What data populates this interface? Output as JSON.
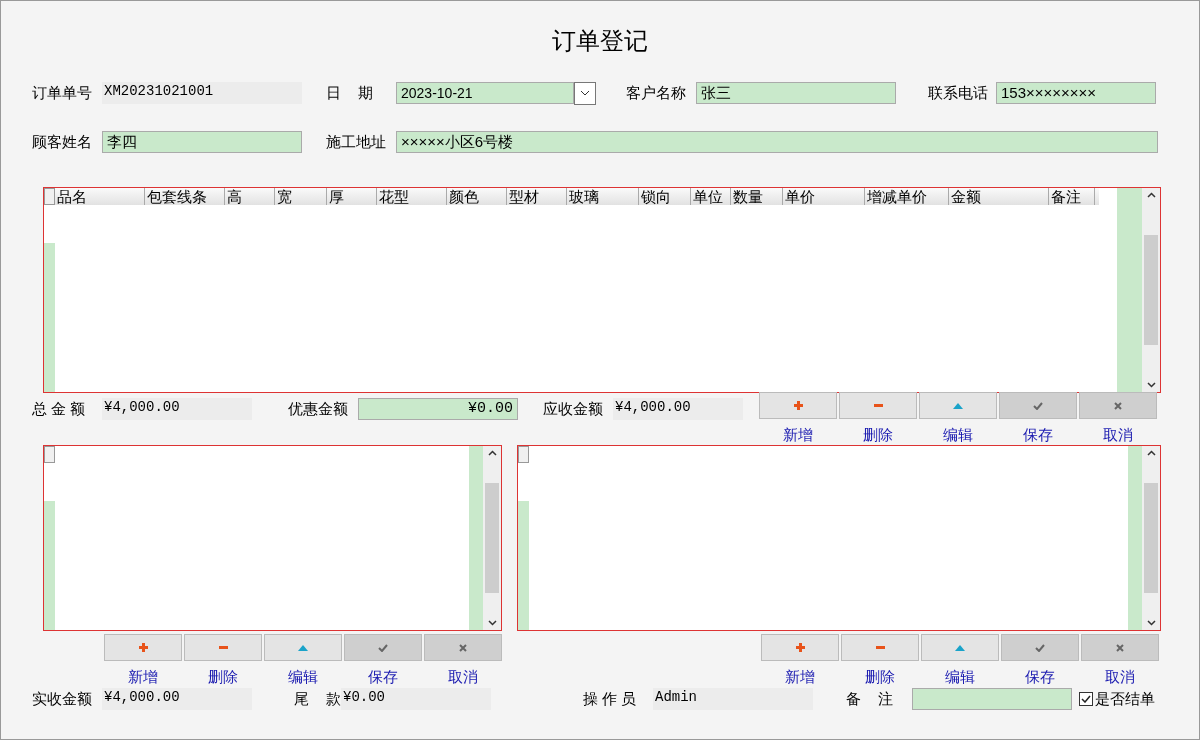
{
  "title": "订单登记",
  "row1": [
    {
      "label": "订单单号",
      "value": "XM20231021001",
      "kind": "readonly"
    },
    {
      "label": "日    期",
      "value": "2023-10-21",
      "kind": "date"
    },
    {
      "label": "客户名称",
      "value": "张三",
      "kind": "input"
    },
    {
      "label": "联系电话",
      "value": "153××××××××",
      "kind": "input"
    }
  ],
  "row2": [
    {
      "label": "顾客姓名",
      "value": "李四",
      "kind": "input"
    },
    {
      "label": "施工地址",
      "value": "×××××小区6号楼",
      "kind": "input"
    }
  ],
  "grid": {
    "columns": [
      "品名",
      "包套线条",
      "高",
      "宽",
      "厚",
      "花型",
      "颜色",
      "型材",
      "玻璃",
      "锁向",
      "单位",
      "数量",
      "单价",
      "增减单价",
      "金额",
      "备注"
    ]
  },
  "totals": [
    {
      "label": "总 金 额",
      "value": "¥4,000.00",
      "kind": "readonly"
    },
    {
      "label": "优惠金额",
      "value": "¥0.00",
      "kind": "input"
    },
    {
      "label": "应收金额",
      "value": "¥4,000.00",
      "kind": "readonly"
    }
  ],
  "toolbars": [
    [
      {
        "label": "新增",
        "kind": "add",
        "disabled": false
      },
      {
        "label": "删除",
        "kind": "delete",
        "disabled": false
      },
      {
        "label": "编辑",
        "kind": "edit",
        "disabled": false
      },
      {
        "label": "保存",
        "kind": "save",
        "disabled": true
      },
      {
        "label": "取消",
        "kind": "cancel",
        "disabled": true
      }
    ],
    [
      {
        "label": "新增",
        "kind": "add",
        "disabled": false
      },
      {
        "label": "删除",
        "kind": "delete",
        "disabled": false
      },
      {
        "label": "编辑",
        "kind": "edit",
        "disabled": false
      },
      {
        "label": "保存",
        "kind": "save",
        "disabled": true
      },
      {
        "label": "取消",
        "kind": "cancel",
        "disabled": true
      }
    ],
    [
      {
        "label": "新增",
        "kind": "add",
        "disabled": false
      },
      {
        "label": "删除",
        "kind": "delete",
        "disabled": false
      },
      {
        "label": "编辑",
        "kind": "edit",
        "disabled": false
      },
      {
        "label": "保存",
        "kind": "save",
        "disabled": true
      },
      {
        "label": "取消",
        "kind": "cancel",
        "disabled": true
      }
    ]
  ],
  "footer": [
    {
      "label": "实收金额",
      "value": "¥4,000.00",
      "kind": "readonly"
    },
    {
      "label": "尾    款",
      "value": "¥0.00",
      "kind": "readonly"
    },
    {
      "label": "操 作 员",
      "value": "Admin",
      "kind": "readonly"
    },
    {
      "label": "备    注",
      "kind": "input"
    }
  ],
  "settled": {
    "label": "是否结单",
    "checked": true
  }
}
